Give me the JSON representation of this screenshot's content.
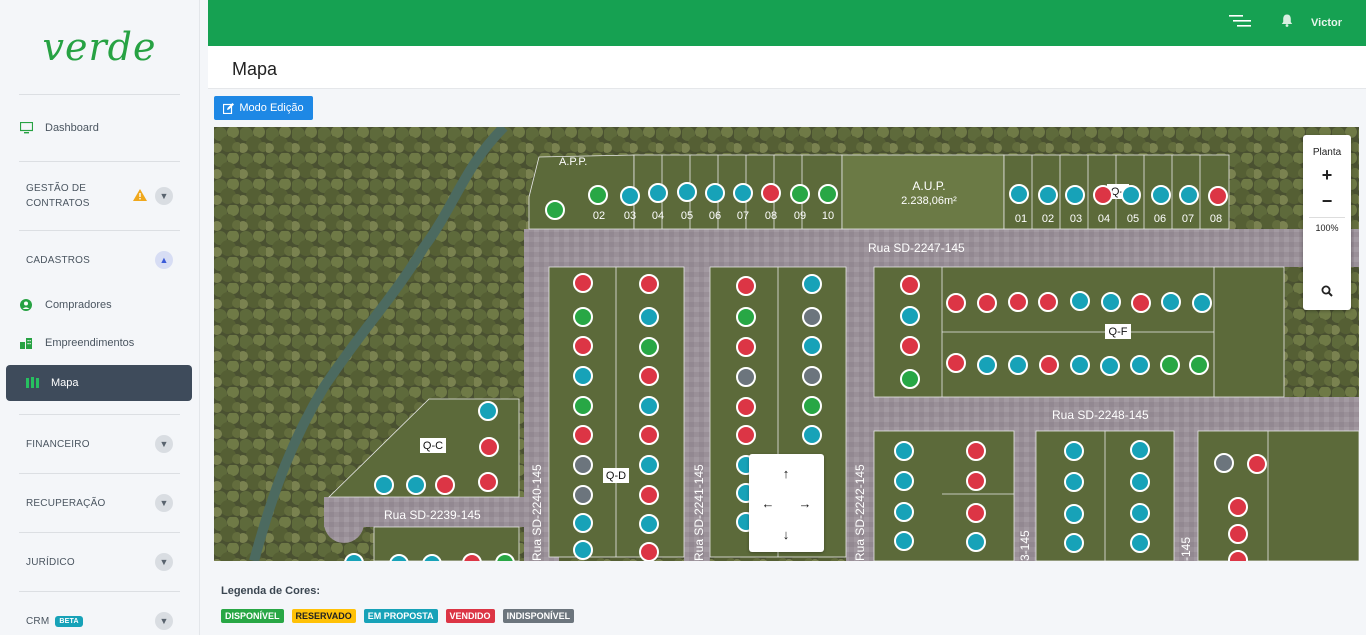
{
  "brand": {
    "logo": "verde",
    "primary": "#16a152"
  },
  "topbar": {
    "user": "Victor",
    "menu_icon": "menu-lines-icon",
    "bell_icon": "bell-icon"
  },
  "page": {
    "title": "Mapa"
  },
  "sidebar": {
    "dashboard": "Dashboard",
    "gestao": "GESTÃO DE\nCONTRATOS",
    "cadastros": "CADASTROS",
    "compradores": "Compradores",
    "empreendimentos": "Empreendimentos",
    "mapa": "Mapa",
    "financeiro": "FINANCEIRO",
    "recuperacao": "RECUPERAÇÃO",
    "juridico": "JURÍDICO",
    "crm": "CRM",
    "crm_badge": "BETA"
  },
  "toolbar": {
    "edit_mode": "Modo Edição"
  },
  "map": {
    "zoom_label": "Planta",
    "zoom_in": "+",
    "zoom_out": "−",
    "zoom_level": "100%",
    "labels": {
      "app": "A.P.P.",
      "aup": "A.U.P.",
      "aup_area": "2.238,06m²",
      "rua_2247": "Rua SD-2247-145",
      "rua_2248": "Rua SD-2248-145",
      "rua_2239": "Rua SD-2239-145",
      "rua_2240": "Rua SD-2240-145",
      "rua_2241": "Rua SD-2241-145",
      "rua_2242": "Rua SD-2242-145",
      "rua_3_145": "3-145",
      "rua_145": "-145",
      "qc": "Q-C",
      "qd": "Q-D",
      "qf": "Q-F",
      "q_top": "Q-"
    },
    "lot_numbers_left": [
      "02",
      "03",
      "04",
      "05",
      "06",
      "07",
      "08",
      "09",
      "10"
    ],
    "lot_numbers_right": [
      "01",
      "02",
      "03",
      "04",
      "05",
      "06",
      "07",
      "08"
    ]
  },
  "legend": {
    "title": "Legenda de Cores:",
    "items": [
      {
        "label": "DISPONÍVEL",
        "color": "#28a745"
      },
      {
        "label": "RESERVADO",
        "color": "#ffc107"
      },
      {
        "label": "EM PROPOSTA",
        "color": "#17a2b8"
      },
      {
        "label": "VENDIDO",
        "color": "#dc3545"
      },
      {
        "label": "INDISPONÍVEL",
        "color": "#6c757d"
      }
    ]
  },
  "status_colors": {
    "g": "#28a745",
    "b": "#17a2b8",
    "r": "#dc3545",
    "x": "#6c757d"
  }
}
